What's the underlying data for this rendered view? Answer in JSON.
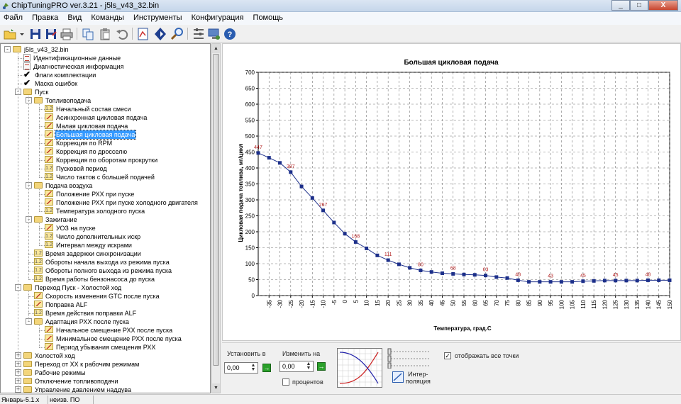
{
  "window": {
    "title": "ChipTuningPRO ver.3.21 - j5ls_v43_32.bin",
    "controls": [
      "_",
      "□",
      "X"
    ]
  },
  "menu": [
    "Файл",
    "Правка",
    "Вид",
    "Команды",
    "Инструменты",
    "Конфигурация",
    "Помощь"
  ],
  "toolbar": {
    "icons": [
      "open-folder-icon",
      "dropdown-arrow-icon",
      "save-icon",
      "save-as-icon",
      "print-icon",
      "copy-icon",
      "paste-icon",
      "undo-icon",
      "map-view-icon",
      "navigate-icon",
      "search-icon",
      "tools-icon",
      "monitor-icon",
      "help-icon"
    ]
  },
  "tree": {
    "items": [
      {
        "level": 0,
        "label": "j5ls_v43_32.bin",
        "icon": "folder",
        "expander": "-"
      },
      {
        "level": 1,
        "label": "Идентификационные данные",
        "icon": "doc"
      },
      {
        "level": 1,
        "label": "Диагностическая информация",
        "icon": "doc"
      },
      {
        "level": 1,
        "label": "Флаги комплектации",
        "icon": "check"
      },
      {
        "level": 1,
        "label": "Маска ошибок",
        "icon": "check"
      },
      {
        "level": 1,
        "label": "Пуск",
        "icon": "folder",
        "expander": "-"
      },
      {
        "level": 2,
        "label": "Топливоподача",
        "icon": "folder",
        "expander": "-"
      },
      {
        "level": 3,
        "label": "Начальный состав смеси",
        "icon": "num"
      },
      {
        "level": 3,
        "label": "Асинхронная цикловая подача",
        "icon": "map"
      },
      {
        "level": 3,
        "label": "Малая цикловая подача",
        "icon": "map"
      },
      {
        "level": 3,
        "label": "Большая цикловая подача",
        "icon": "map",
        "selected": true
      },
      {
        "level": 3,
        "label": "Коррекция по RPM",
        "icon": "map"
      },
      {
        "level": 3,
        "label": "Коррекция по дросселю",
        "icon": "map"
      },
      {
        "level": 3,
        "label": "Коррекция по оборотам прокрутки",
        "icon": "map"
      },
      {
        "level": 3,
        "label": "Пусковой период",
        "icon": "num"
      },
      {
        "level": 3,
        "label": "Число тактов с большей подачей",
        "icon": "num"
      },
      {
        "level": 2,
        "label": "Подача воздуха",
        "icon": "folder",
        "expander": "-"
      },
      {
        "level": 3,
        "label": "Положение РХХ при пуске",
        "icon": "map"
      },
      {
        "level": 3,
        "label": "Положение РХХ при пуске холодного двигателя",
        "icon": "map"
      },
      {
        "level": 3,
        "label": "Температура холодного пуска",
        "icon": "num"
      },
      {
        "level": 2,
        "label": "Зажигание",
        "icon": "folder",
        "expander": "-"
      },
      {
        "level": 3,
        "label": "УОЗ на пуске",
        "icon": "map"
      },
      {
        "level": 3,
        "label": "Число дополнительных искр",
        "icon": "num"
      },
      {
        "level": 3,
        "label": "Интервал между искрами",
        "icon": "num"
      },
      {
        "level": 2,
        "label": "Время задержки синхронизации",
        "icon": "num"
      },
      {
        "level": 2,
        "label": "Обороты начала выхода из режима пуска",
        "icon": "num"
      },
      {
        "level": 2,
        "label": "Обороты полного выхода из режима пуска",
        "icon": "num"
      },
      {
        "level": 2,
        "label": "Время работы бензонасоса до пуска",
        "icon": "num"
      },
      {
        "level": 1,
        "label": "Переход Пуск - Холостой ход",
        "icon": "folder",
        "expander": "-"
      },
      {
        "level": 2,
        "label": "Скорость изменения GTC после пуска",
        "icon": "map"
      },
      {
        "level": 2,
        "label": "Поправка ALF",
        "icon": "map"
      },
      {
        "level": 2,
        "label": "Время действия поправки ALF",
        "icon": "num"
      },
      {
        "level": 2,
        "label": "Адаптация РХХ после пуска",
        "icon": "folder",
        "expander": "-"
      },
      {
        "level": 3,
        "label": "Начальное смещение РХХ после пуска",
        "icon": "map"
      },
      {
        "level": 3,
        "label": "Минимальное смещение РХХ после пуска",
        "icon": "map"
      },
      {
        "level": 3,
        "label": "Период убывания смещения РХХ",
        "icon": "map"
      },
      {
        "level": 1,
        "label": "Холостой ход",
        "icon": "folder",
        "expander": "+"
      },
      {
        "level": 1,
        "label": "Переход от ХХ к рабочим режимам",
        "icon": "folder",
        "expander": "+"
      },
      {
        "level": 1,
        "label": "Рабочие режимы",
        "icon": "folder",
        "expander": "+"
      },
      {
        "level": 1,
        "label": "Отключение топливоподачи",
        "icon": "folder",
        "expander": "+"
      },
      {
        "level": 1,
        "label": "Управление давлением наддува",
        "icon": "folder",
        "expander": "+"
      }
    ]
  },
  "chart_data": {
    "type": "line",
    "title": "Большая цикловая подача",
    "xlabel": "Температура, град.С",
    "ylabel": "Цикловая подача топлива, мг/цикл",
    "x": [
      -40,
      -35,
      -30,
      -25,
      -20,
      -15,
      -10,
      -5,
      0,
      5,
      10,
      15,
      20,
      25,
      30,
      35,
      40,
      45,
      50,
      55,
      60,
      65,
      70,
      75,
      80,
      85,
      90,
      95,
      100,
      105,
      110,
      115,
      120,
      125,
      130,
      135,
      140,
      145,
      150
    ],
    "x_ticks": [
      -35,
      -30,
      -25,
      -20,
      -15,
      -10,
      -5,
      0,
      5,
      10,
      15,
      20,
      25,
      30,
      35,
      40,
      45,
      50,
      55,
      60,
      65,
      70,
      75,
      80,
      85,
      90,
      95,
      100,
      105,
      110,
      115,
      120,
      125,
      130,
      135,
      140,
      145,
      150
    ],
    "series": [
      {
        "values": [
          447,
          432,
          416,
          387,
          342,
          306,
          267,
          229,
          194,
          168,
          148,
          126,
          111,
          98,
          87,
          79,
          74,
          70,
          68,
          66,
          65,
          63,
          58,
          55,
          48,
          43,
          43,
          43,
          43,
          43,
          45,
          46,
          47,
          47,
          47,
          47,
          48,
          48,
          48
        ]
      }
    ],
    "data_labels": [
      {
        "x": -40,
        "label": "447"
      },
      {
        "x": -25,
        "label": "387"
      },
      {
        "x": -10,
        "label": "267"
      },
      {
        "x": 5,
        "label": "168"
      },
      {
        "x": 20,
        "label": "111"
      },
      {
        "x": 35,
        "label": "80"
      },
      {
        "x": 50,
        "label": "68"
      },
      {
        "x": 65,
        "label": "63"
      },
      {
        "x": 80,
        "label": "48"
      },
      {
        "x": 95,
        "label": "43"
      },
      {
        "x": 110,
        "label": "45"
      },
      {
        "x": 125,
        "label": "45"
      },
      {
        "x": 140,
        "label": "48"
      }
    ],
    "ylim": [
      0,
      700
    ],
    "y_ticks": [
      0,
      50,
      100,
      150,
      200,
      250,
      300,
      350,
      400,
      450,
      500,
      550,
      600,
      650,
      700
    ],
    "xlim": [
      -40,
      150
    ],
    "grid": true,
    "line_color": "#1c2f8a",
    "label_color": "#b22222"
  },
  "controls": {
    "set_label": "Установить в",
    "set_value": "0,00",
    "change_label": "Изменить на",
    "change_value": "0,00",
    "percent_label": "процентов",
    "interp_label_1": "Интер-",
    "interp_label_2": "поляция",
    "show_points_label": "отображать все точки"
  },
  "status": {
    "cell1": "Январь-5.1.x",
    "cell2": "неизв. ПО"
  }
}
